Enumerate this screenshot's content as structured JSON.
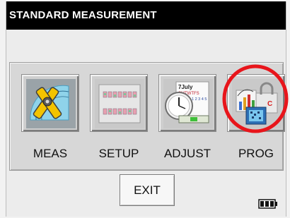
{
  "window": {
    "title": "STANDARD MEASUREMENT"
  },
  "menu": {
    "items": [
      {
        "label": "MEAS",
        "icon": "measurement-protractor-icon"
      },
      {
        "label": "SETUP",
        "icon": "setup-panel-icon"
      },
      {
        "label": "ADJUST",
        "icon": "adjust-calendar-clock-icon"
      },
      {
        "label": "PROG",
        "icon": "program-chart-lock-icon"
      }
    ]
  },
  "calendar": {
    "month": "7July",
    "weekdays": "SMTWTFS",
    "numbers": "1 2 3 4 5"
  },
  "footer": {
    "exit_label": "EXIT",
    "battery_icon": "battery-icon"
  },
  "colors": {
    "highlight": "#e8151b",
    "title_bar": "#000000"
  }
}
